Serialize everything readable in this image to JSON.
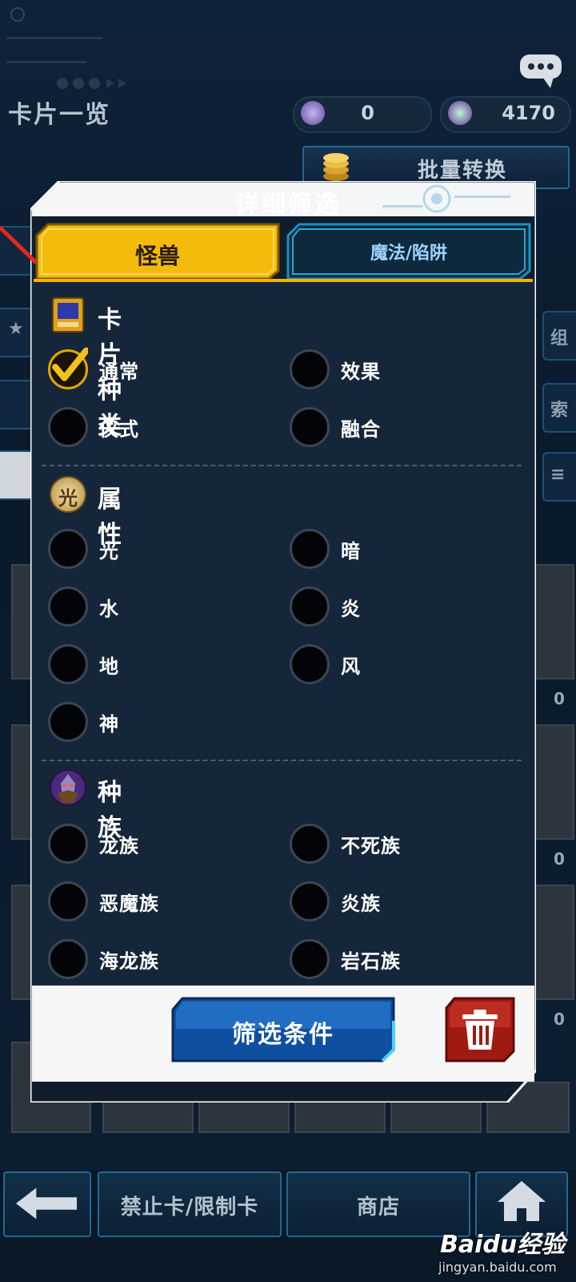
{
  "header": {
    "title": "卡片一览"
  },
  "currencies": [
    {
      "icon": "orb-icon",
      "value": "0"
    },
    {
      "icon": "gem-icon",
      "value": "4170"
    }
  ],
  "bulk_convert": {
    "label": "批量转换"
  },
  "side_right_labels": [
    "组",
    "索"
  ],
  "card_counts": [
    "0",
    "0",
    "0"
  ],
  "dialog": {
    "title": "详细筛选",
    "tabs": [
      {
        "label": "怪兽",
        "active": true
      },
      {
        "label": "魔法/陷阱",
        "active": false
      }
    ],
    "sections": [
      {
        "title": "卡片种类",
        "icon": "card-type-icon",
        "options": [
          {
            "label": "通常",
            "checked": true
          },
          {
            "label": "效果",
            "checked": false
          },
          {
            "label": "仪式",
            "checked": false
          },
          {
            "label": "融合",
            "checked": false
          }
        ]
      },
      {
        "title": "属性",
        "icon": "light-attribute-icon",
        "icon_text": "光",
        "options": [
          {
            "label": "光",
            "checked": false
          },
          {
            "label": "暗",
            "checked": false
          },
          {
            "label": "水",
            "checked": false
          },
          {
            "label": "炎",
            "checked": false
          },
          {
            "label": "地",
            "checked": false
          },
          {
            "label": "风",
            "checked": false
          },
          {
            "label": "神",
            "checked": false
          }
        ]
      },
      {
        "title": "种族",
        "icon": "fiend-race-icon",
        "options": [
          {
            "label": "龙族",
            "checked": false
          },
          {
            "label": "不死族",
            "checked": false
          },
          {
            "label": "恶魔族",
            "checked": false
          },
          {
            "label": "炎族",
            "checked": false
          },
          {
            "label": "海龙族",
            "checked": false
          },
          {
            "label": "岩石族",
            "checked": false
          }
        ]
      }
    ],
    "filter_button": {
      "label": "筛选条件"
    },
    "clear_button": {
      "icon": "trash-icon"
    }
  },
  "bottom_nav": [
    {
      "label": "",
      "icon": "back-arrow-icon"
    },
    {
      "label": "禁止卡/限制卡"
    },
    {
      "label": "商店"
    },
    {
      "label": "",
      "icon": "home-icon"
    }
  ],
  "watermark": {
    "main": "Baidu经验",
    "sub": "jingyan.baidu.com"
  },
  "colors": {
    "accent_gold": "#f0b400",
    "dialog_bg": "#16263a",
    "tab_blue": "#1a8fc4",
    "button_blue": "#1667b8",
    "trash_red": "#a01a12"
  }
}
